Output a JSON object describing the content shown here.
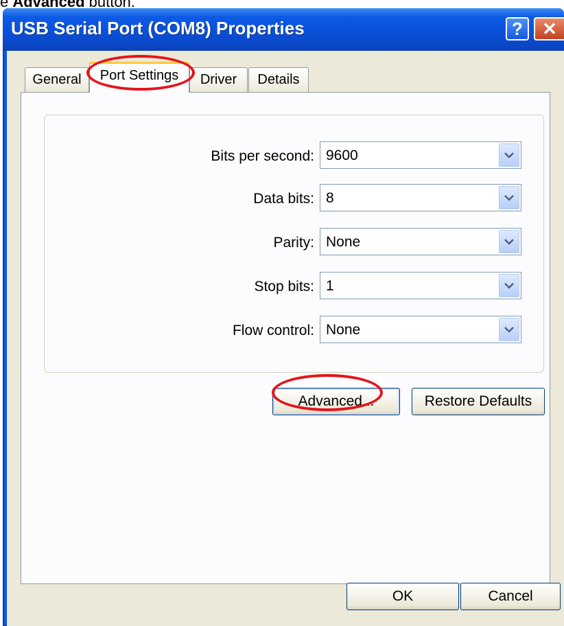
{
  "caption": {
    "prefix": "e ",
    "bold": "Advanced",
    "suffix": " button."
  },
  "window": {
    "title": "USB Serial Port (COM8) Properties",
    "help_label": "?",
    "close_label": "✕"
  },
  "tabs": [
    {
      "label": "General"
    },
    {
      "label": "Port Settings"
    },
    {
      "label": "Driver"
    },
    {
      "label": "Details"
    }
  ],
  "active_tab": "Port Settings",
  "settings": {
    "bits_per_second": {
      "label": "Bits per second:",
      "value": "9600"
    },
    "data_bits": {
      "label": "Data bits:",
      "value": "8"
    },
    "parity": {
      "label": "Parity:",
      "value": "None"
    },
    "stop_bits": {
      "label": "Stop bits:",
      "value": "1"
    },
    "flow_control": {
      "label": "Flow control:",
      "value": "None"
    }
  },
  "buttons": {
    "advanced": "Advanced...",
    "restore_defaults": "Restore Defaults",
    "ok": "OK",
    "cancel": "Cancel"
  },
  "colors": {
    "titlebar": "#0a4fd6",
    "annotation": "#e5141b",
    "client": "#ece9d8"
  }
}
